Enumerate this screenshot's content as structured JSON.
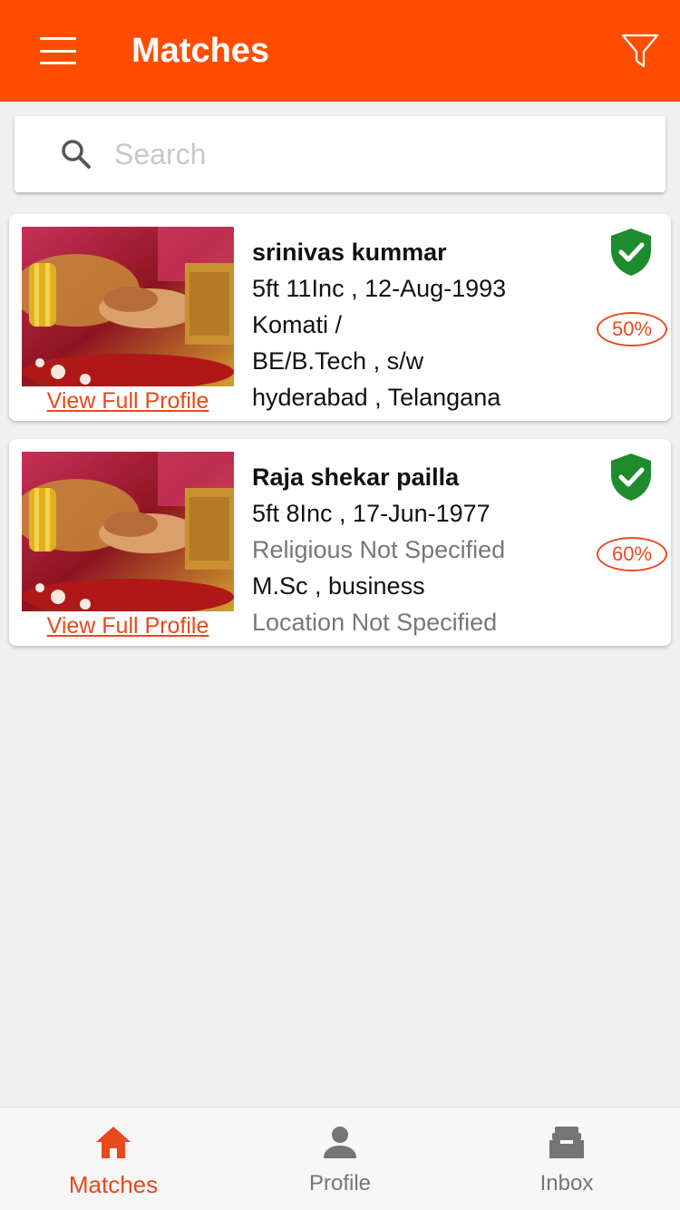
{
  "header": {
    "title": "Matches",
    "menu_icon": "menu-icon",
    "filter_icon": "filter-icon",
    "bg_color": "#ff4d00"
  },
  "search": {
    "placeholder": "Search",
    "value": "",
    "icon": "search-icon"
  },
  "matches": [
    {
      "name": "srinivas kummar",
      "height_dob": "5ft 11Inc ,  12-Aug-1993",
      "religion": "Komati /",
      "education_job": "BE/B.Tech ,  s/w",
      "location": "hyderabad ,  Telangana",
      "match_percent": "50%",
      "link_label": "View Full Profile",
      "verified_icon": "verified-shield-icon"
    },
    {
      "name": "Raja shekar pailla",
      "height_dob": "5ft 8Inc ,  17-Jun-1977",
      "religion": "Religious Not Specified",
      "education_job": "M.Sc ,  business",
      "location": "Location Not Specified",
      "match_percent": "60%",
      "link_label": "View Full Profile",
      "verified_icon": "verified-shield-icon"
    }
  ],
  "bottom_nav": {
    "items": [
      {
        "label": "Matches",
        "icon": "home-icon",
        "active": true
      },
      {
        "label": "Profile",
        "icon": "person-icon",
        "active": false
      },
      {
        "label": "Inbox",
        "icon": "inbox-icon",
        "active": false
      }
    ]
  },
  "colors": {
    "accent": "#ff4d00",
    "link": "#e8491d",
    "verified": "#1e8c2e"
  }
}
